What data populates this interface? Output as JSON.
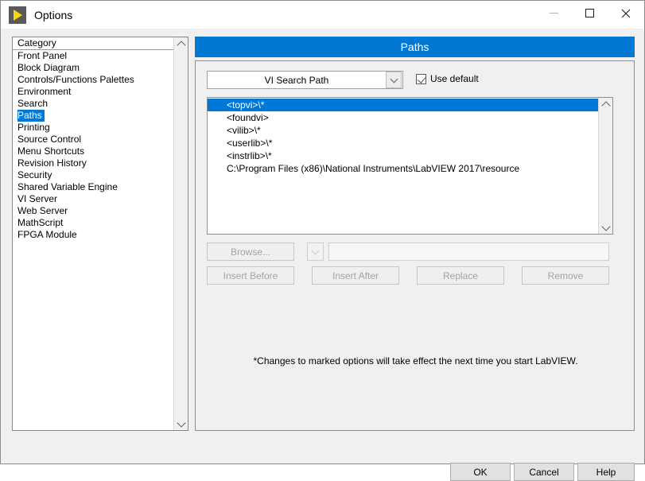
{
  "window": {
    "title": "Options",
    "app_icon": "labview-run-arrow-icon",
    "controls": {
      "minimize": "minimize-icon",
      "maximize": "maximize-icon",
      "close": "close-icon"
    }
  },
  "category_list": {
    "header": "Category",
    "selected": "Paths",
    "items": [
      "Front Panel",
      "Block Diagram",
      "Controls/Functions Palettes",
      "Environment",
      "Search",
      "Paths",
      "Printing",
      "Source Control",
      "Menu Shortcuts",
      "Revision History",
      "Security",
      "Shared Variable Engine",
      "VI Server",
      "Web Server",
      "MathScript",
      "FPGA Module"
    ]
  },
  "panel": {
    "banner_title": "Paths",
    "path_type": {
      "selected": "VI Search Path"
    },
    "use_default": {
      "label": "Use default",
      "checked": true
    },
    "path_entries": [
      "<topvi>\\*",
      "<foundvi>",
      "<vilib>\\*",
      "<userlib>\\*",
      "<instrlib>\\*",
      "C:\\Program Files (x86)\\National Instruments\\LabVIEW 2017\\resource"
    ],
    "selected_path_index": 0,
    "path_edit_value": "",
    "buttons": {
      "browse": "Browse...",
      "insert_before": "Insert Before",
      "insert_after": "Insert After",
      "replace": "Replace",
      "remove": "Remove"
    },
    "footnote": "*Changes to marked options will take effect the next time you start LabVIEW."
  },
  "footer": {
    "ok": "OK",
    "cancel": "Cancel",
    "help": "Help"
  },
  "colors": {
    "accent_blue": "#0078d4",
    "selection_blue": "#0078d7",
    "dialog_bg": "#f0f0f0",
    "icon_yellow": "#ffd40a"
  }
}
